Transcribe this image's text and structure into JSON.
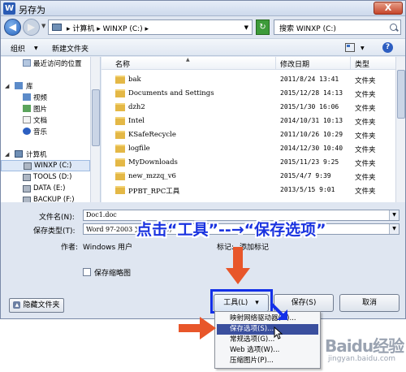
{
  "window": {
    "app_icon": "W",
    "title": "另存为",
    "close_label": "X"
  },
  "address": {
    "back_glyph": "◀",
    "forward_glyph": "▶",
    "path": "▸ 计算机 ▸ WINXP (C:) ▸",
    "refresh_glyph": "↻",
    "search_placeholder": "搜索 WINXP (C:)"
  },
  "toolbar": {
    "organize": "组织",
    "new_folder": "新建文件夹",
    "help": "?"
  },
  "nav": {
    "items": [
      {
        "label": "最近访问的位置",
        "icon": "recent-places-icon"
      },
      {
        "label": "库",
        "icon": "library-icon"
      },
      {
        "label": "视频",
        "icon": "video-icon"
      },
      {
        "label": "图片",
        "icon": "pictures-icon"
      },
      {
        "label": "文档",
        "icon": "documents-icon"
      },
      {
        "label": "音乐",
        "icon": "music-icon"
      },
      {
        "label": "计算机",
        "icon": "computer-icon"
      },
      {
        "label": "WINXP (C:)",
        "icon": "drive-icon"
      },
      {
        "label": "TOOLS (D:)",
        "icon": "drive-icon"
      },
      {
        "label": "DATA (E:)",
        "icon": "drive-icon"
      },
      {
        "label": "BACKUP (F:)",
        "icon": "drive-icon"
      }
    ]
  },
  "files": {
    "columns": {
      "name": "名称",
      "date": "修改日期",
      "type": "类型"
    },
    "rows": [
      {
        "name": "bak",
        "date": "2011/8/24 13:41",
        "type": "文件夹"
      },
      {
        "name": "Documents and Settings",
        "date": "2015/12/28 14:13",
        "type": "文件夹"
      },
      {
        "name": "dzh2",
        "date": "2015/1/30 16:06",
        "type": "文件夹"
      },
      {
        "name": "Intel",
        "date": "2014/10/31 10:13",
        "type": "文件夹"
      },
      {
        "name": "KSafeRecycle",
        "date": "2011/10/26 10:29",
        "type": "文件夹"
      },
      {
        "name": "logfile",
        "date": "2014/12/30 10:40",
        "type": "文件夹"
      },
      {
        "name": "MyDownloads",
        "date": "2015/11/23 9:25",
        "type": "文件夹"
      },
      {
        "name": "new_mzzq_v6",
        "date": "2015/4/7 9:39",
        "type": "文件夹"
      },
      {
        "name": "PPBT_RPC工具",
        "date": "2013/5/15 9:01",
        "type": "文件夹"
      }
    ]
  },
  "form": {
    "filename_label": "文件名(N):",
    "filename_value": "Doc1.doc",
    "filetype_label": "保存类型(T):",
    "filetype_value": "Word 97-2003 文档 (*.doc)",
    "author_label": "作者:",
    "author_value": "Windows 用户",
    "tags_label": "标记:",
    "tags_value": "添加标记",
    "thumbnail_label": "保存缩略图"
  },
  "buttons": {
    "hide_folders": "隐藏文件夹",
    "tools": "工具(L)",
    "tools_arrow": "▾",
    "save": "保存(S)",
    "cancel": "取消"
  },
  "menu": {
    "items": [
      {
        "label": "映射网络驱动器(M)...",
        "selected": false
      },
      {
        "label": "保存选项(S)...",
        "selected": true
      },
      {
        "label": "常规选项(G)...",
        "selected": false
      },
      {
        "label": "Web 选项(W)...",
        "selected": false
      },
      {
        "label": "压缩图片(P)...",
        "selected": false
      }
    ]
  },
  "annotation": {
    "text": "点击“工具”--→“保存选项”",
    "color": "#1a33e0",
    "highlight_color": "#1330e8",
    "arrow_color": "#e8562a"
  },
  "watermark": {
    "logo": "Baidu经验",
    "sub": "jingyan.baidu.com"
  }
}
